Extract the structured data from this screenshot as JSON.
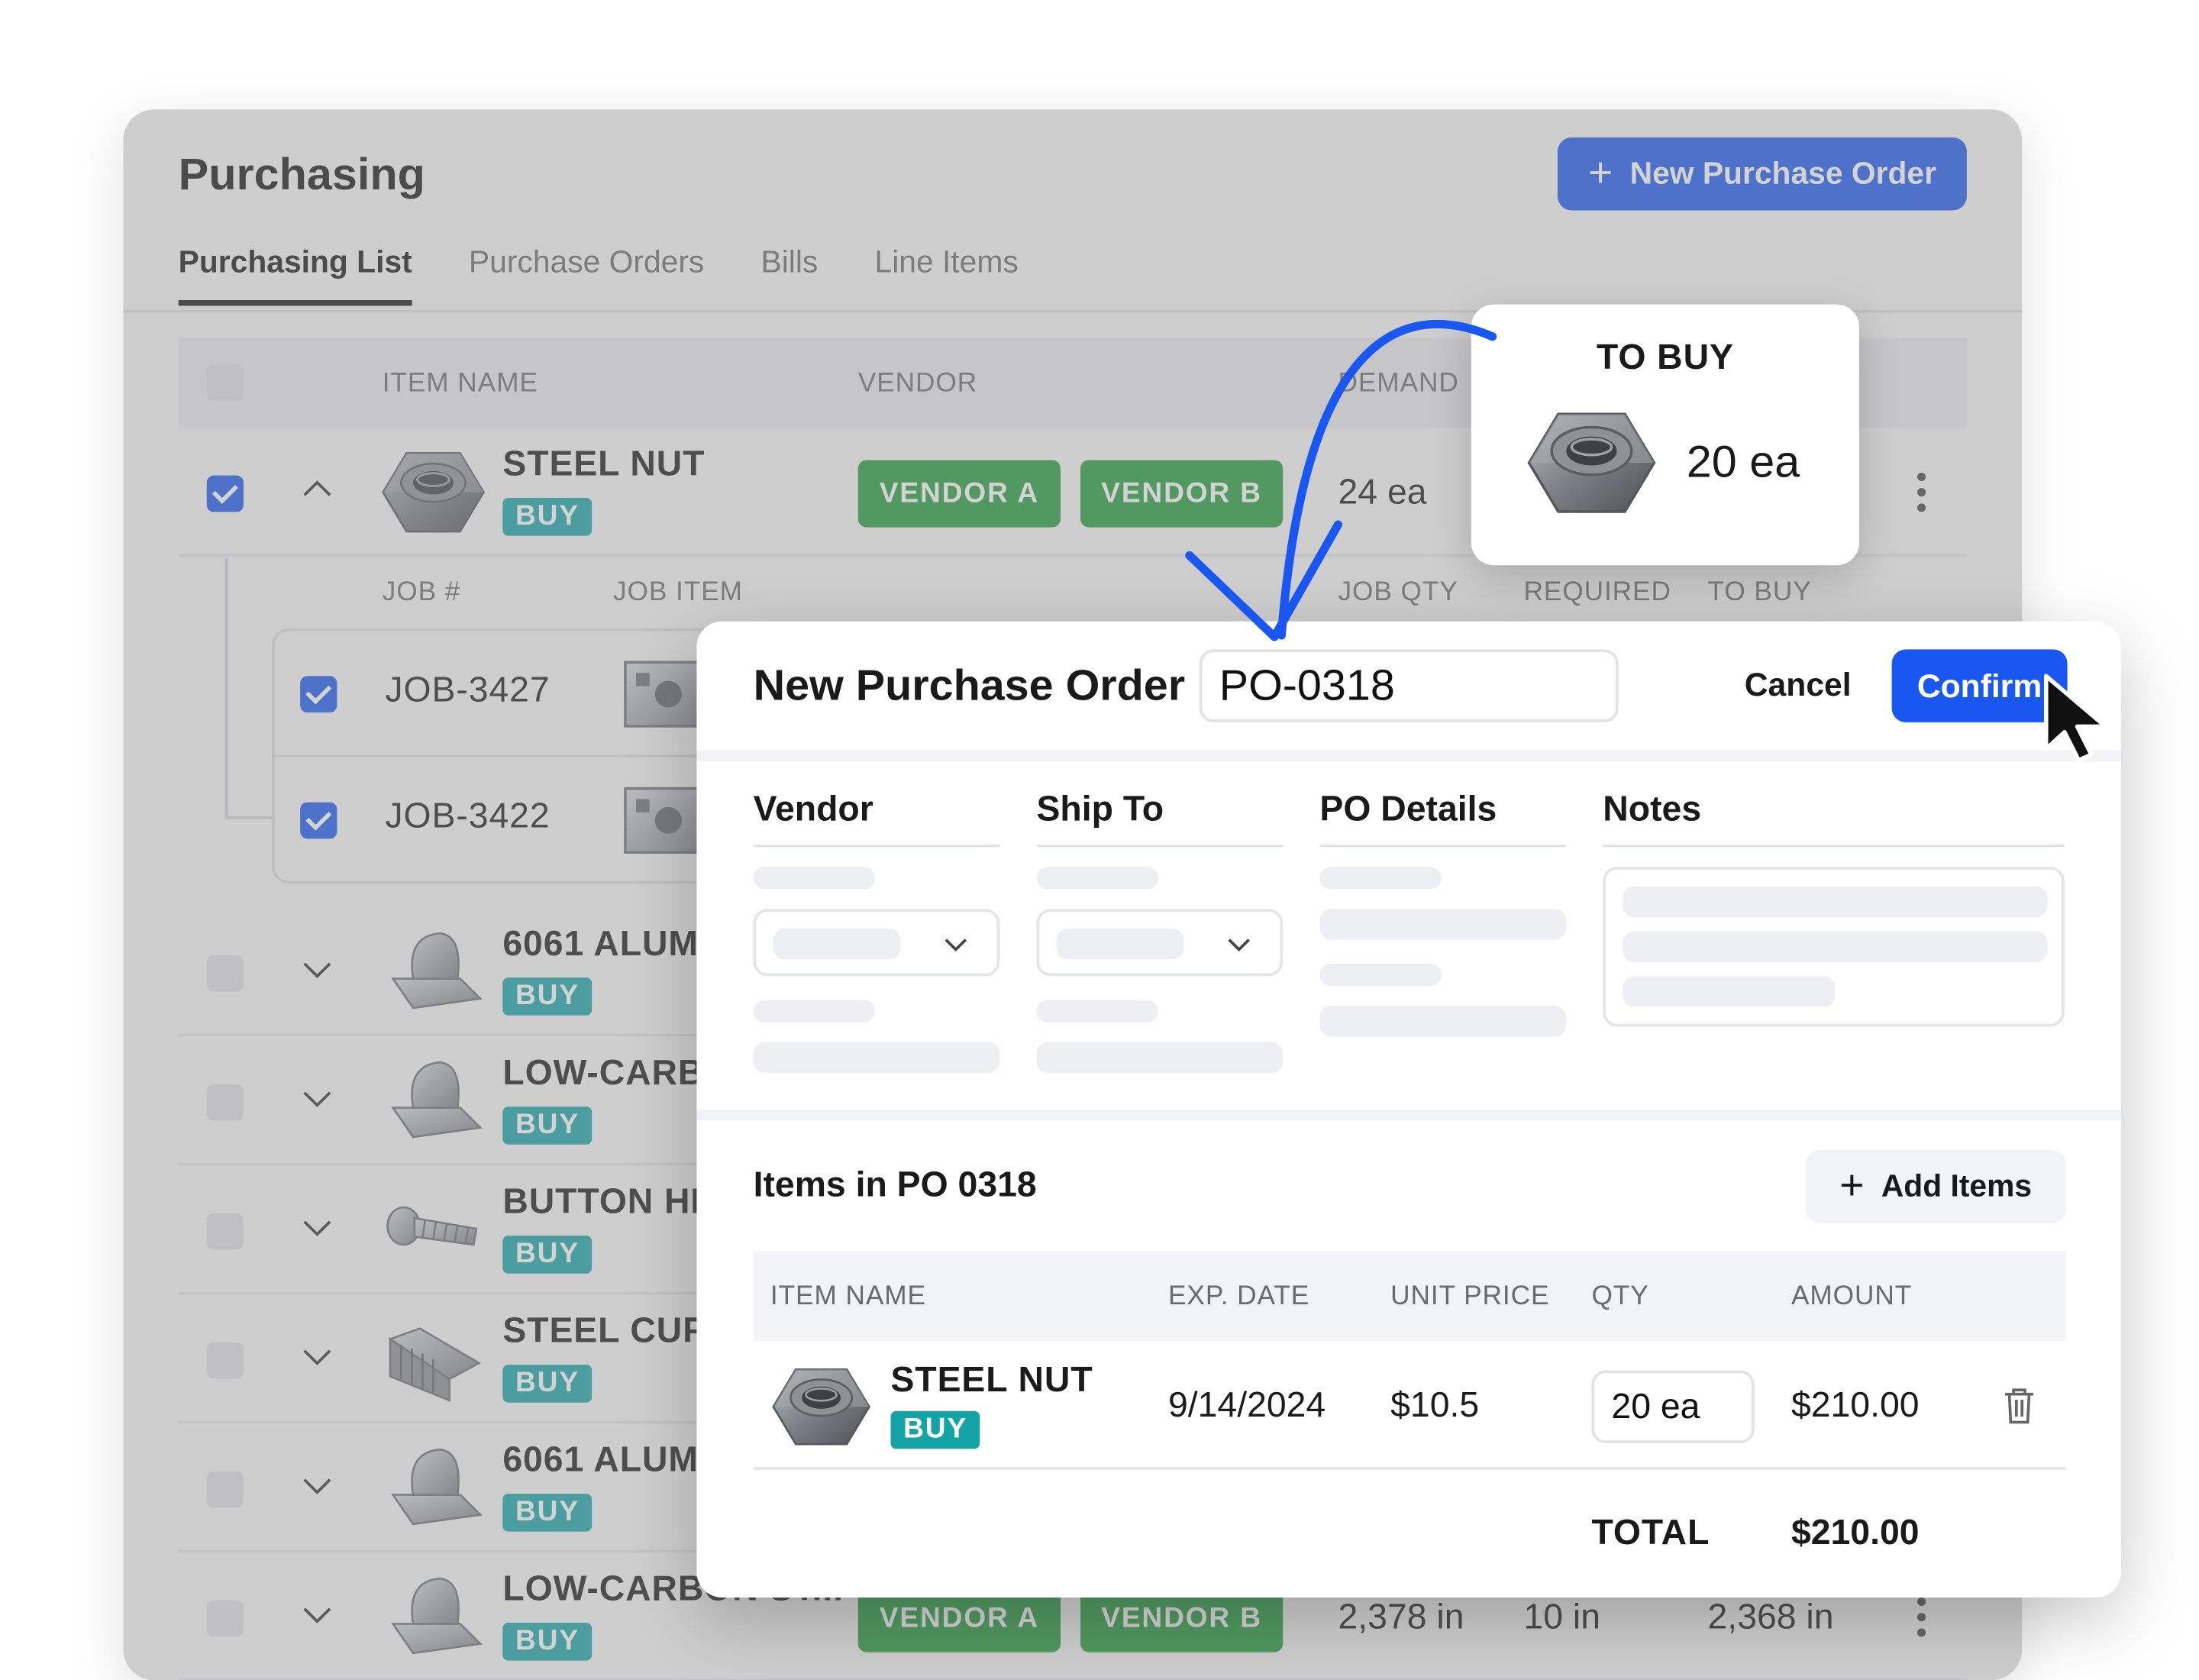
{
  "app": {
    "title": "Purchasing",
    "new_po_label": "New Purchase Order",
    "tabs": [
      "Purchasing List",
      "Purchase Orders",
      "Bills",
      "Line Items"
    ],
    "table_headers": {
      "item_name": "ITEM NAME",
      "vendor": "VENDOR",
      "demand": "DEMAND"
    },
    "sub_headers": {
      "job_no": "JOB #",
      "job_item": "JOB ITEM",
      "job_qty": "JOB QTY",
      "required": "REQUIRED",
      "to_buy": "TO BUY"
    },
    "rows": [
      {
        "name": "STEEL NUT",
        "tag": "BUY",
        "vendor_a": "VENDOR A",
        "vendor_b": "VENDOR B",
        "demand": "24 ea"
      },
      {
        "name": "6061 ALUM",
        "tag": "BUY"
      },
      {
        "name": "LOW-CARB",
        "tag": "BUY"
      },
      {
        "name": "BUTTON HE",
        "tag": "BUY"
      },
      {
        "name": "STEEL CUP",
        "tag": "BUY"
      },
      {
        "name": "6061 ALUM",
        "tag": "BUY"
      },
      {
        "name": "LOW-CARBON ST...",
        "tag": "BUY",
        "vendor_a": "VENDOR A",
        "vendor_b": "VENDOR B",
        "demand": "2,378 in",
        "required": "10 in",
        "to_buy": "2,368 in"
      }
    ],
    "jobs": [
      "JOB-3427",
      "JOB-3422"
    ]
  },
  "to_buy_popover": {
    "title": "TO BUY",
    "qty": "20 ea"
  },
  "modal": {
    "title": "New Purchase Order",
    "po_number": "PO-0318",
    "cancel_label": "Cancel",
    "confirm_label": "Confirm",
    "sections": [
      "Vendor",
      "Ship To",
      "PO Details",
      "Notes"
    ],
    "items_title": "Items in PO 0318",
    "add_items_label": "Add Items",
    "item_headers": {
      "item_name": "ITEM NAME",
      "exp_date": "EXP. DATE",
      "unit_price": "UNIT PRICE",
      "qty": "QTY",
      "amount": "AMOUNT"
    },
    "item": {
      "name": "STEEL NUT",
      "tag": "BUY",
      "exp_date": "9/14/2024",
      "unit_price": "$10.5",
      "qty": "20 ea",
      "amount": "$210.00"
    },
    "total_label": "TOTAL",
    "total_value": "$210.00"
  },
  "colors": {
    "primary": "#1a56f0",
    "vendor_green": "#1f9c3a",
    "buy_teal": "#16a3a6"
  }
}
